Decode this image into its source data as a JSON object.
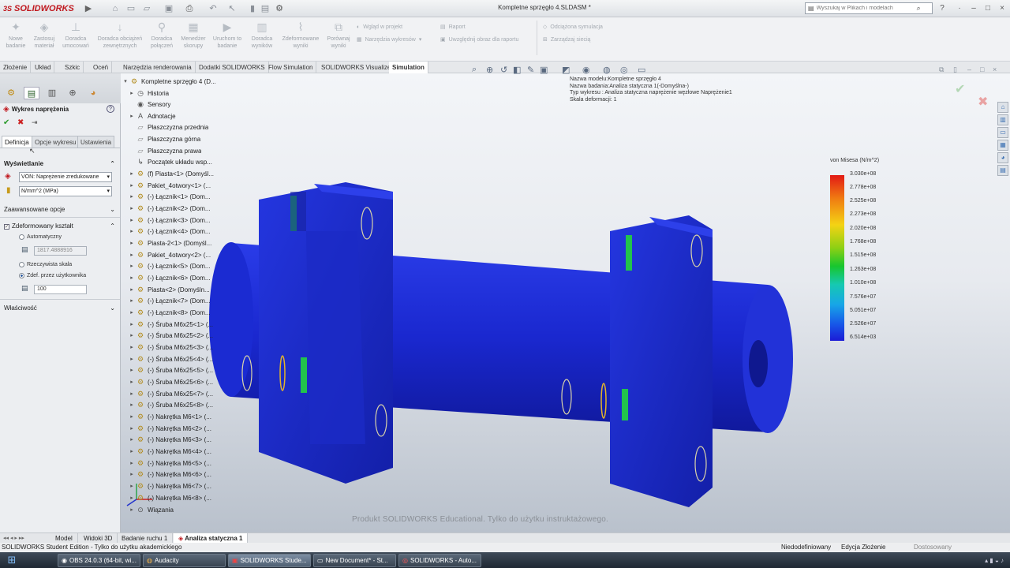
{
  "app": {
    "logo_text": "SOLIDWORKS",
    "doc_title": "Kompletne sprzęgło 4.SLDASM *"
  },
  "search": {
    "placeholder": "Wyszukaj w Plikach i modelach"
  },
  "ribbon": {
    "big_buttons": [
      "Nowe badanie",
      "Zastosuj materiał",
      "Doradca umocowań",
      "Doradca obciążeń zewnętrznych",
      "Doradca połączeń",
      "Menedżer skorupy",
      "Uruchom to badanie",
      "Doradca wyników",
      "Zdeformowane wyniki",
      "Porównaj wyniki"
    ],
    "small_buttons": {
      "wglad": "Wgląd w projekt",
      "narzedzia": "Narzędzia wykresów",
      "raport": "Raport",
      "uwzglednij": "Uwzględnij obraz dla raportu",
      "odciazona": "Odciążona symulacja",
      "zarzadzaj": "Zarządzaj siecią"
    }
  },
  "tabs": [
    "Złożenie",
    "Układ",
    "Szkic",
    "Oceń",
    "Narzędzia renderowania",
    "Dodatki SOLIDWORKS",
    "Flow Simulation",
    "SOLIDWORKS Visualize",
    "Simulation"
  ],
  "active_tab": "Simulation",
  "panel": {
    "title": "Wykres naprężenia",
    "subtabs": [
      "Definicja",
      "Opcje wykresu",
      "Ustawienia"
    ],
    "display_header": "Wyświetlanie",
    "component": "VON: Naprężenie zredukowane",
    "units": "N/mm^2 (MPa)",
    "advanced_header": "Zaawansowane opcje",
    "deformed_header": "Zdeformowany kształt",
    "auto_label": "Automatyczny",
    "auto_value": "1817.4888916",
    "true_scale": "Rzeczywista skala",
    "user_defined": "Zdef. przez użytkownika",
    "user_value": "100",
    "properties_header": "Właściwość"
  },
  "tree": [
    {
      "label": "Kompletne sprzęgło 4  (D...",
      "icon": "assembly-icon"
    },
    {
      "label": "Historia",
      "icon": "history-icon"
    },
    {
      "label": "Sensory",
      "icon": "sensor-icon"
    },
    {
      "label": "Adnotacje",
      "icon": "annotation-icon"
    },
    {
      "label": "Płaszczyzna przednia",
      "icon": "plane-icon"
    },
    {
      "label": "Płaszczyzna górna",
      "icon": "plane-icon"
    },
    {
      "label": "Płaszczyzna prawa",
      "icon": "plane-icon"
    },
    {
      "label": "Początek układu wsp...",
      "icon": "origin-icon"
    },
    {
      "label": "(f) Piasta<1> (Domyśl...",
      "icon": "part-icon"
    },
    {
      "label": "Pakiet_4otwory<1> (...",
      "icon": "part-icon"
    },
    {
      "label": "(-) Łącznik<1> (Dom...",
      "icon": "part-icon"
    },
    {
      "label": "(-) Łącznik<2> (Dom...",
      "icon": "part-icon"
    },
    {
      "label": "(-) Łącznik<3> (Dom...",
      "icon": "part-icon"
    },
    {
      "label": "(-) Łącznik<4> (Dom...",
      "icon": "part-icon"
    },
    {
      "label": "Piasta-2<1> (Domyśl...",
      "icon": "part-icon"
    },
    {
      "label": "Pakiet_4otwory<2> (...",
      "icon": "part-icon"
    },
    {
      "label": "(-) Łącznik<5> (Dom...",
      "icon": "part-icon"
    },
    {
      "label": "(-) Łącznik<6> (Dom...",
      "icon": "part-icon"
    },
    {
      "label": "Piasta<2> (Domyśln...",
      "icon": "part-icon"
    },
    {
      "label": "(-) Łącznik<7> (Dom...",
      "icon": "part-icon"
    },
    {
      "label": "(-) Łącznik<8> (Dom...",
      "icon": "part-icon"
    },
    {
      "label": "(-) Śruba M6x25<1> (...",
      "icon": "part-icon"
    },
    {
      "label": "(-) Śruba M6x25<2> (...",
      "icon": "part-icon"
    },
    {
      "label": "(-) Śruba M6x25<3> (...",
      "icon": "part-icon"
    },
    {
      "label": "(-) Śruba M6x25<4> (...",
      "icon": "part-icon"
    },
    {
      "label": "(-) Śruba M6x25<5> (...",
      "icon": "part-icon"
    },
    {
      "label": "(-) Śruba M6x25<6> (...",
      "icon": "part-icon"
    },
    {
      "label": "(-) Śruba M6x25<7> (...",
      "icon": "part-icon"
    },
    {
      "label": "(-) Śruba M6x25<8> (...",
      "icon": "part-icon"
    },
    {
      "label": "(-) Nakrętka M6<1> (...",
      "icon": "part-icon"
    },
    {
      "label": "(-) Nakrętka M6<2> (...",
      "icon": "part-icon"
    },
    {
      "label": "(-) Nakrętka M6<3> (...",
      "icon": "part-icon"
    },
    {
      "label": "(-) Nakrętka M6<4> (...",
      "icon": "part-icon"
    },
    {
      "label": "(-) Nakrętka M6<5> (...",
      "icon": "part-icon"
    },
    {
      "label": "(-) Nakrętka M6<6> (...",
      "icon": "part-icon"
    },
    {
      "label": "(-) Nakrętka M6<7> (...",
      "icon": "part-icon"
    },
    {
      "label": "(-) Nakrętka M6<8> (...",
      "icon": "part-icon"
    },
    {
      "label": "Wiązania",
      "icon": "mates-icon"
    }
  ],
  "meta": [
    "Nazwa modelu:Kompletne sprzęgło 4",
    "Nazwa badania:Analiza statyczna 1(-Domyślna-)",
    "Typ wykresu : Analiza statyczna naprężenie węzłowe Naprężenie1",
    "Skala deformacji: 1"
  ],
  "legend": {
    "title": "von Misesa (N/m^2)",
    "values": [
      "3.030e+08",
      "2.778e+08",
      "2.525e+08",
      "2.273e+08",
      "2.020e+08",
      "1.768e+08",
      "1.515e+08",
      "1.263e+08",
      "1.010e+08",
      "7.576e+07",
      "5.051e+07",
      "2.526e+07",
      "6.514e+03"
    ]
  },
  "watermark": "Produkt SOLIDWORKS Educational. Tylko do użytku instruktażowego.",
  "bottom_tabs": [
    "Model",
    "Widoki 3D",
    "Badanie ruchu 1",
    "Analiza statyczna 1"
  ],
  "status": {
    "left": "SOLIDWORKS Student Edition - Tylko do użytku akademickiego",
    "state": "Niedodefiniowany",
    "mode": "Edycja Złożenie",
    "custom": "Dostosowany"
  },
  "taskbar": [
    "OBS 24.0.3 (64-bit, wi...",
    "Audacity",
    "SOLIDWORKS Stude...",
    "New Document* - St...",
    "SOLIDWORKS - Auto..."
  ],
  "colors": {
    "accent_red": "#c0171d",
    "model_blue": "#1a2ed1",
    "legend_max": "#e21a15",
    "legend_min": "#1b1bd6"
  }
}
